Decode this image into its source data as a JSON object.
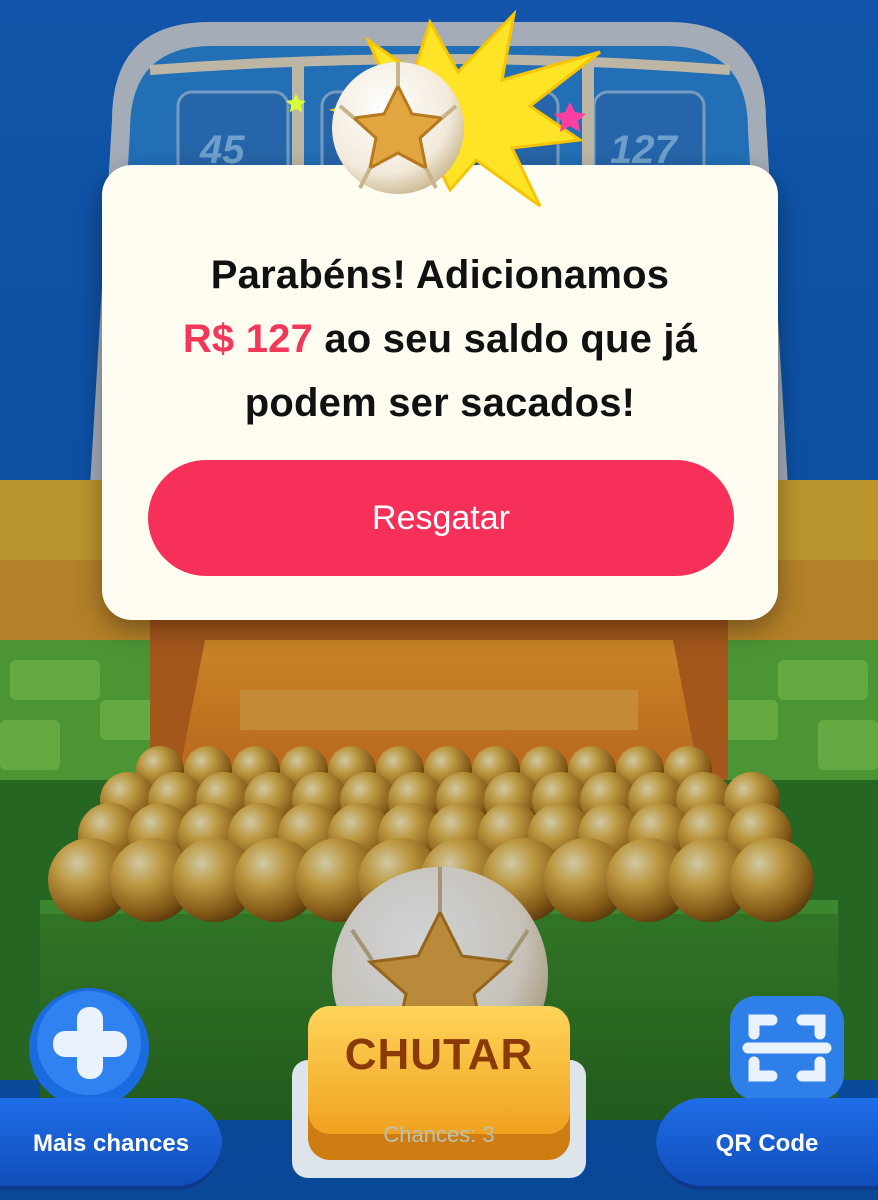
{
  "slots": {
    "left_value": "45",
    "right_value": "127"
  },
  "modal": {
    "line1": "Parabéns! Adicionamos",
    "amount": "R$ 127",
    "line2_rest": " ao seu saldo que já",
    "line3": "podem ser sacados!",
    "button_label": "Resgatar"
  },
  "controls": {
    "kick_label": "CHUTAR",
    "chances_label": "Chances: 3",
    "more_chances_label": "Mais chances",
    "qr_code_label": "QR Code"
  },
  "colors": {
    "accent": "#f7305a",
    "amount_text": "#f2385a",
    "modal_bg": "#fffdf1",
    "hud_blue": "#1a63d8",
    "kick_button": "#f5b323"
  },
  "icons": [
    "soccer-ball-icon",
    "star-burst-icon",
    "plus-icon",
    "qr-scan-icon"
  ]
}
